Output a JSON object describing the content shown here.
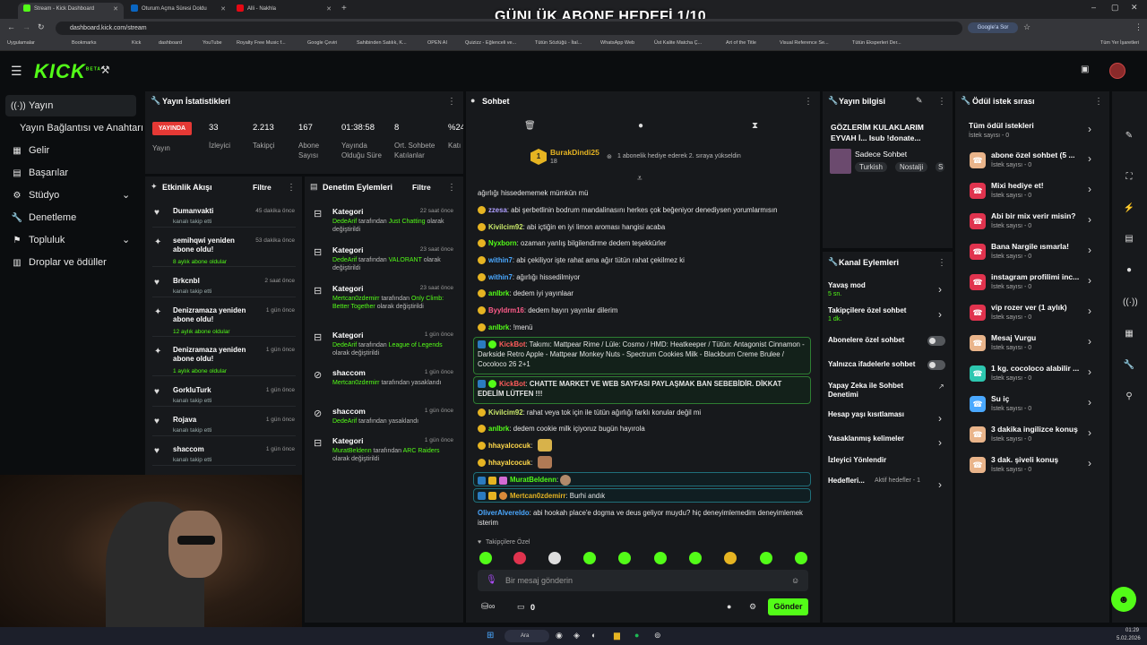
{
  "overlay_title": "GÜNLÜK ABONE HEDEFİ 1/10",
  "browser": {
    "tabs": [
      {
        "label": "Stream - Kick Dashboard",
        "color": "#53fc18"
      },
      {
        "label": "Oturum Açma Süresi Doldu",
        "color": "#0a66c2"
      },
      {
        "label": "Alli - Nakhla",
        "color": "#e50914"
      }
    ],
    "url": "dashboard.kick.com/stream",
    "google_btn": "Google'a Sor",
    "bookmarks": [
      "Uygulamalar",
      "Bookmarks",
      "Kick",
      "dashboard",
      "YouTube",
      "Royalty Free Music f...",
      "Google Çeviri",
      "Sahibinden Satılık, K...",
      "OPEN AI",
      "Quizizz - Eğlenceli ve...",
      "Tütün Sözlüğü - İtal...",
      "WhatsApp Web",
      "Üst Kalite Matcha Ç...",
      "Art of the Title",
      "Visual Reference Se...",
      "Tütün Eksperleri Der..."
    ],
    "all_bookmarks": "Tüm Yer İşaretleri"
  },
  "brand": {
    "logo": "KICK",
    "beta": "BETA",
    "accent": "#53fc18"
  },
  "nav": {
    "items": [
      "Yayın",
      "Yayın Bağlantısı ve Anahtarı",
      "Gelir",
      "Başarılar",
      "Stüdyo",
      "Denetleme",
      "Topluluk",
      "Droplar ve ödüller"
    ]
  },
  "stats": {
    "title": "Yayın İstatistikleri",
    "live_badge": "YAYINDA",
    "live_label": "Yayın",
    "items": [
      {
        "value": "33",
        "label": "İzleyici"
      },
      {
        "value": "2.213",
        "label": "Takipçi"
      },
      {
        "value": "167",
        "label": "Abone Sayısı"
      },
      {
        "value": "01:38:58",
        "label": "Yayında Olduğu Süre"
      },
      {
        "value": "8",
        "label": "Ort. Sohbete Katılanlar"
      },
      {
        "value": "%24",
        "label": "Katı"
      }
    ]
  },
  "activity": {
    "title": "Etkinlik Akışı",
    "filter": "Filtre",
    "items": [
      {
        "name": "Dumanvakti",
        "sub": "kanalı takip etti",
        "time": "45 dakika önce",
        "icon": "♥"
      },
      {
        "name": "semihqwi yeniden abone oldu!",
        "sub": "8 aylık abone oldular",
        "time": "53 dakika önce",
        "icon": "✦"
      },
      {
        "name": "Brkcnbl",
        "sub": "kanalı takip etti",
        "time": "2 saat önce",
        "icon": "♥"
      },
      {
        "name": "Denizramaza yeniden abone oldu!",
        "sub": "12 aylık abone oldular",
        "time": "1 gün önce",
        "icon": "✦"
      },
      {
        "name": "Denizramaza yeniden abone oldu!",
        "sub": "1 aylık abone oldular",
        "time": "1 gün önce",
        "icon": "✦"
      },
      {
        "name": "GorkluTurk",
        "sub": "kanalı takip etti",
        "time": "1 gün önce",
        "icon": "♥"
      },
      {
        "name": "Rojava",
        "sub": "kanalı takip etti",
        "time": "1 gün önce",
        "icon": "♥"
      },
      {
        "name": "shaccom",
        "sub": "kanalı takip etti",
        "time": "1 gün önce",
        "icon": "♥"
      }
    ]
  },
  "moderation": {
    "title": "Denetim Eylemleri",
    "filter": "Filtre",
    "items": [
      {
        "title": "Kategori",
        "time": "22 saat önce",
        "user": "DedeArif",
        "mid": " tarafından ",
        "target": "Just Chatting",
        "end": "olarak değiştirildi",
        "icon": "⊟"
      },
      {
        "title": "Kategori",
        "time": "23 saat önce",
        "user": "DedeArif",
        "mid": " tarafından ",
        "target": "VALORANT",
        "end": "olarak değiştirildi",
        "icon": "⊟"
      },
      {
        "title": "Kategori",
        "time": "23 saat önce",
        "user": "Mertcan0zdemirr",
        "mid": " tarafından ",
        "target": "Only Climb: Better Together",
        "end": "olarak değiştirildi",
        "icon": "⊟"
      },
      {
        "title": "Kategori",
        "time": "1 gün önce",
        "user": "DedeArif",
        "mid": " tarafından ",
        "target": "League of Legends",
        "end": "olarak değiştirildi",
        "icon": "⊟"
      },
      {
        "title": "shaccom",
        "time": "1 gün önce",
        "user": "Mertcan0zdemirr",
        "mid": " tarafından ",
        "target": "",
        "end": "yasaklandı",
        "icon": "⊘"
      },
      {
        "title": "shaccom",
        "time": "1 gün önce",
        "user": "DedeArif",
        "mid": " tarafından yasaklandı",
        "target": "",
        "end": "",
        "icon": "⊘"
      },
      {
        "title": "Kategori",
        "time": "1 gün önce",
        "user": "MuratBeldenn",
        "mid": " tarafından ",
        "target": "ARC Raiders",
        "end": "olarak değiştirildi",
        "icon": "⊟"
      }
    ]
  },
  "chat": {
    "title": "Sohbet",
    "pinned": {
      "user": "BurakDindi25",
      "count": "18",
      "rank": "1",
      "text": "1 abonelik hediye ederek 2. sıraya yükseldin"
    },
    "messages": [
      {
        "user": "",
        "color": "#e6e6e6",
        "text": "ağırlığı hissedememek mümkün mü"
      },
      {
        "user": "zzesa",
        "color": "#b0a0ff",
        "text": "abi şerbetlinin bodrum mandalinasını herkes çok beğeniyor denediysen yorumlarmısın"
      },
      {
        "user": "Kivilcim92",
        "color": "#c9e86a",
        "text": "abi içtiğin en iyi limon aroması hangisi acaba"
      },
      {
        "user": "Nyxborn",
        "color": "#53fc18",
        "text": "ozaman yanlış bilgilendirme dedem teşekkürler"
      },
      {
        "user": "within7",
        "color": "#4aa8ff",
        "text": "abi çekiliyor işte rahat ama ağır tütün rahat çekilmez ki"
      },
      {
        "user": "within7",
        "color": "#4aa8ff",
        "text": "ağırlığı hissedilmiyor"
      },
      {
        "user": "anlbrk",
        "color": "#53fc18",
        "text": "dedem iyi yayınlaar"
      },
      {
        "user": "Byyldrm16",
        "color": "#ff5c8a",
        "text": "dedem hayırı yayınlar dilerim"
      },
      {
        "user": "anlbrk",
        "color": "#53fc18",
        "text": "!menü"
      }
    ],
    "bot1": {
      "user": "KickBot",
      "text": "Takımı: Mattpear Rime / Lüle: Cosmo / HMD: Heatkeeper / Tütün: Antagonist Cinnamon - Darkside Retro Apple - Mattpear Monkey Nuts - Spectrum Cookies Milk - Blackburn Creme Brulee / Cocoloco 26 2+1"
    },
    "bot2": {
      "user": "KickBot",
      "text": "CHATTE MARKET VE WEB SAYFASI PAYLAŞMAK BAN SEBEBİDİR. DİKKAT EDELİM LÜTFEN !!!"
    },
    "messages2": [
      {
        "user": "Kivilcim92",
        "color": "#c9e86a",
        "text": "rahat veya tok için ile tütün ağırlığı farklı konular değil mi"
      },
      {
        "user": "anlbrk",
        "color": "#53fc18",
        "text": "dedem cookie milk içiyoruz bugün hayırola"
      },
      {
        "user": "hhayalcocuk",
        "color": "#ffd84a",
        "text": ""
      },
      {
        "user": "hhayalcocuk",
        "color": "#ffd84a",
        "text": ""
      }
    ],
    "mod1": {
      "user": "MuratBeldenn",
      "text": ""
    },
    "mod2": {
      "user": "Mertcan0zdemirr",
      "text": "Burhi andık"
    },
    "last": {
      "user": "OliverAlvereldo",
      "color": "#4aa8ff",
      "text": "abi hookah place'e dogma ve deus geliyor muydu? hiç deneyimlemedim deneyimlemek isterim"
    },
    "follower_only": "Takipçilere Özel",
    "placeholder": "Bir mesaj gönderin",
    "points": "0",
    "send": "Gönder"
  },
  "stream_info": {
    "title": "Yayın bilgisi",
    "stream_title": "GÖZLERİM KULAKLARIM EYVAH İ... Isub !donate...",
    "category": "Sadece Sohbet",
    "tags": [
      "Turkish",
      "Nostalji",
      "S"
    ]
  },
  "channel_actions": {
    "title": "Kanal Eylemleri",
    "items": [
      {
        "label": "Yavaş mod",
        "sub": "5 sn.",
        "control": "chevron"
      },
      {
        "label": "Takipçilere özel sohbet",
        "sub": "1 dk.",
        "control": "chevron"
      },
      {
        "label": "Abonelere özel sohbet",
        "sub": "",
        "control": "toggle"
      },
      {
        "label": "Yalnızca ifadelerle sohbet",
        "sub": "",
        "control": "toggle"
      },
      {
        "label": "Yapay Zeka ile Sohbet Denetimi",
        "sub": "",
        "control": "external"
      },
      {
        "label": "Hesap yaşı kısıtlaması",
        "sub": "",
        "control": "chevron"
      },
      {
        "label": "Yasaklanmış kelimeler",
        "sub": "",
        "control": "chevron"
      },
      {
        "label": "İzleyici Yönlendir",
        "sub": "",
        "control": "none"
      },
      {
        "label": "Hedefleri...",
        "sub": "Aktif hedefler - 1",
        "control": "chevron"
      }
    ]
  },
  "rewards": {
    "title": "Ödül istek sırası",
    "all": {
      "label": "Tüm ödül istekleri",
      "count": "İstek sayısı - 0"
    },
    "items": [
      {
        "label": "abone özel sohbet (5 ...",
        "count": "İstek sayısı - 0",
        "color": "#e9b48a"
      },
      {
        "label": "Mixi hediye et!",
        "count": "İstek sayısı - 0",
        "color": "#e0334e"
      },
      {
        "label": "Abi bir mix verir misin?",
        "count": "İstek sayısı - 0",
        "color": "#e0334e"
      },
      {
        "label": "Bana Nargile ısmarla!",
        "count": "İstek sayısı - 0",
        "color": "#e0334e"
      },
      {
        "label": "instagram profilimi inc...",
        "count": "İstek sayısı - 0",
        "color": "#e0334e"
      },
      {
        "label": "vip rozer ver (1 aylık)",
        "count": "İstek sayısı - 0",
        "color": "#e0334e"
      },
      {
        "label": "Mesaj Vurgu",
        "count": "İstek sayısı - 0",
        "color": "#e9b48a"
      },
      {
        "label": "1 kg. cocoloco alabilir ...",
        "count": "İstek sayısı - 0",
        "color": "#2dc7b0"
      },
      {
        "label": "Su iç",
        "count": "İstek sayısı - 0",
        "color": "#4aa8ff"
      },
      {
        "label": "3 dakika ingilizce konuş",
        "count": "İstek sayısı - 0",
        "color": "#e9b48a"
      },
      {
        "label": "3 dak. şiveli konuş",
        "count": "İstek sayısı - 0",
        "color": "#e9b48a"
      }
    ]
  },
  "taskbar": {
    "search": "Ara",
    "time": "01:29",
    "date": "5.02.2026"
  }
}
